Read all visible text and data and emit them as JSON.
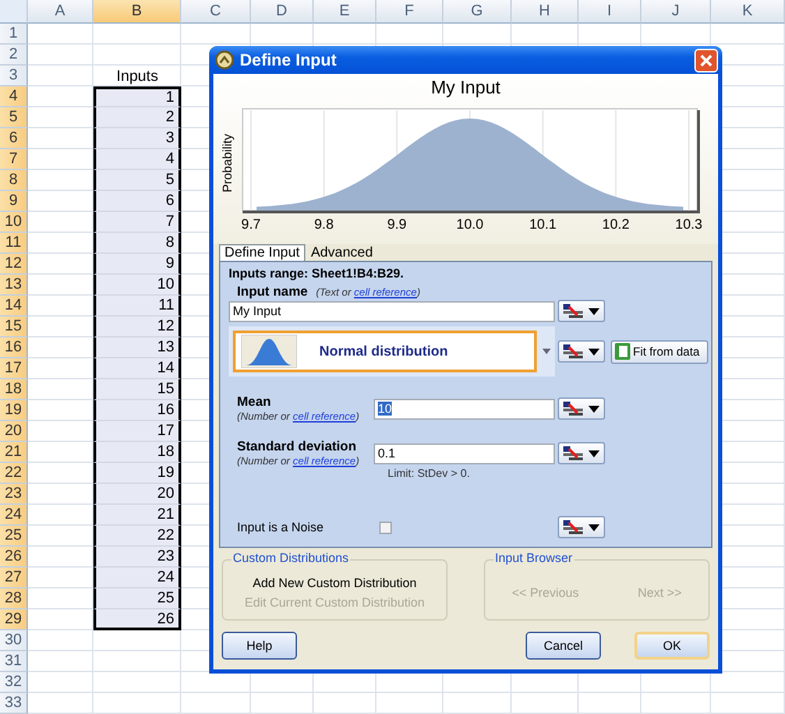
{
  "sheet": {
    "columns": [
      {
        "label": "A",
        "selected": false
      },
      {
        "label": "B",
        "selected": true
      },
      {
        "label": "C",
        "selected": false
      },
      {
        "label": "D",
        "selected": false
      },
      {
        "label": "E",
        "selected": false
      },
      {
        "label": "F",
        "selected": false
      },
      {
        "label": "G",
        "selected": false
      },
      {
        "label": "H",
        "selected": false
      },
      {
        "label": "I",
        "selected": false
      },
      {
        "label": "J",
        "selected": false
      },
      {
        "label": "K",
        "selected": false
      }
    ],
    "rows": [
      {
        "label": "1",
        "selected": false
      },
      {
        "label": "2",
        "selected": false
      },
      {
        "label": "3",
        "selected": false,
        "value": "Inputs"
      },
      {
        "label": "4",
        "selected": true,
        "value": "1"
      },
      {
        "label": "5",
        "selected": true,
        "value": "2"
      },
      {
        "label": "6",
        "selected": true,
        "value": "3"
      },
      {
        "label": "7",
        "selected": true,
        "value": "4"
      },
      {
        "label": "8",
        "selected": true,
        "value": "5"
      },
      {
        "label": "9",
        "selected": true,
        "value": "6"
      },
      {
        "label": "10",
        "selected": true,
        "value": "7"
      },
      {
        "label": "11",
        "selected": true,
        "value": "8"
      },
      {
        "label": "12",
        "selected": true,
        "value": "9"
      },
      {
        "label": "13",
        "selected": true,
        "value": "10"
      },
      {
        "label": "14",
        "selected": true,
        "value": "11"
      },
      {
        "label": "15",
        "selected": true,
        "value": "12"
      },
      {
        "label": "16",
        "selected": true,
        "value": "13"
      },
      {
        "label": "17",
        "selected": true,
        "value": "14"
      },
      {
        "label": "18",
        "selected": true,
        "value": "15"
      },
      {
        "label": "19",
        "selected": true,
        "value": "16"
      },
      {
        "label": "20",
        "selected": true,
        "value": "17"
      },
      {
        "label": "21",
        "selected": true,
        "value": "18"
      },
      {
        "label": "22",
        "selected": true,
        "value": "19"
      },
      {
        "label": "23",
        "selected": true,
        "value": "20"
      },
      {
        "label": "24",
        "selected": true,
        "value": "21"
      },
      {
        "label": "25",
        "selected": true,
        "value": "22"
      },
      {
        "label": "26",
        "selected": true,
        "value": "23"
      },
      {
        "label": "27",
        "selected": true,
        "value": "24"
      },
      {
        "label": "28",
        "selected": true,
        "value": "25"
      },
      {
        "label": "29",
        "selected": true,
        "value": "26"
      },
      {
        "label": "30",
        "selected": false
      },
      {
        "label": "31",
        "selected": false
      },
      {
        "label": "32",
        "selected": false
      },
      {
        "label": "33",
        "selected": false
      }
    ]
  },
  "dialog": {
    "title": "Define Input",
    "chart": {
      "title": "My Input",
      "ylabel": "Probability",
      "xtick_labels": [
        "9.7",
        "9.8",
        "9.9",
        "10.0",
        "10.1",
        "10.2",
        "10.3"
      ]
    },
    "tabs": [
      {
        "label": "Define Input",
        "selected": true
      },
      {
        "label": "Advanced",
        "selected": false
      }
    ],
    "range_text": "Inputs range: Sheet1!B4:B29.",
    "input_name": {
      "label": "Input name",
      "hint_before": "(Text or",
      "hint_link": "cell reference",
      "hint_after": ")",
      "value": "My Input"
    },
    "distribution": {
      "label": "Normal distribution",
      "fit_button": "Fit from data"
    },
    "parameters": [
      {
        "label": "Mean",
        "hint_before": "(Number or",
        "hint_link": "cell reference",
        "hint_after": ")",
        "value": "10",
        "selected": true
      },
      {
        "label": "Standard deviation",
        "hint_before": "(Number or",
        "hint_link": "cell reference",
        "hint_after": ")",
        "value": "0.1",
        "selected": false,
        "note": "Limit: StDev > 0."
      }
    ],
    "noise": {
      "label": "Input is a Noise",
      "checked": false
    },
    "groups": [
      {
        "title": "Custom Distributions",
        "actions": [
          {
            "label": "Add New Custom Distribution",
            "disabled": false
          },
          {
            "label": "Edit Current Custom Distribution",
            "disabled": true
          }
        ]
      },
      {
        "title": "Input Browser",
        "actions": [
          {
            "label": "<< Previous",
            "disabled": true
          },
          {
            "label": "Next >>",
            "disabled": true
          }
        ]
      }
    ],
    "buttons": [
      {
        "label": "Help",
        "default": false
      },
      {
        "label": "Cancel",
        "default": false
      },
      {
        "label": "OK",
        "default": true
      }
    ]
  }
}
